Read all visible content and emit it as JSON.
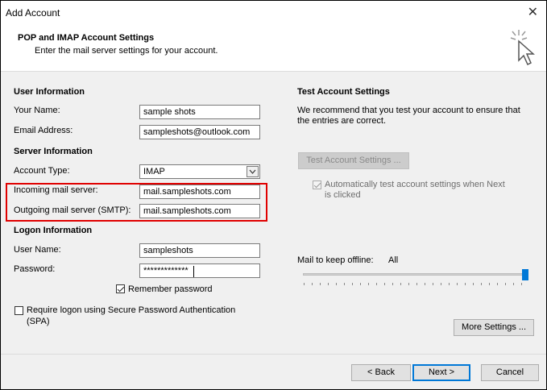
{
  "window": {
    "title": "Add Account"
  },
  "header": {
    "title": "POP and IMAP Account Settings",
    "subtitle": "Enter the mail server settings for your account."
  },
  "user_info": {
    "heading": "User Information",
    "name_label": "Your Name:",
    "name_value": "sample shots",
    "email_label": "Email Address:",
    "email_value": "sampleshots@outlook.com"
  },
  "server_info": {
    "heading": "Server Information",
    "account_type_label": "Account Type:",
    "account_type_value": "IMAP",
    "incoming_label": "Incoming mail server:",
    "incoming_value": "mail.sampleshots.com",
    "outgoing_label": "Outgoing mail server (SMTP):",
    "outgoing_value": "mail.sampleshots.com"
  },
  "logon_info": {
    "heading": "Logon Information",
    "user_label": "User Name:",
    "user_value": "sampleshots",
    "password_label": "Password:",
    "password_value": "*************",
    "remember_label": "Remember password",
    "remember_checked": true,
    "spa_label_line1": "Require logon using Secure Password Authentication",
    "spa_label_line2": "(SPA)",
    "spa_checked": false
  },
  "test_settings": {
    "heading": "Test Account Settings",
    "desc_line1": "We recommend that you test your account to ensure that",
    "desc_line2": "the entries are correct.",
    "button_label": "Test Account Settings ...",
    "auto_test_line1": "Automatically test account settings when Next",
    "auto_test_line2": "is clicked",
    "auto_test_checked": true
  },
  "offline": {
    "label": "Mail to keep offline:",
    "value": "All",
    "slider_fraction": 1.0
  },
  "buttons": {
    "more_settings": "More Settings ...",
    "back": "< Back",
    "next": "Next >",
    "cancel": "Cancel"
  },
  "colors": {
    "highlight_box": "#e00000",
    "accent": "#0078d7"
  },
  "icons": {
    "close": "close-icon",
    "wizard": "cursor-sparkle-icon",
    "dropdown": "chevron-down-icon"
  }
}
